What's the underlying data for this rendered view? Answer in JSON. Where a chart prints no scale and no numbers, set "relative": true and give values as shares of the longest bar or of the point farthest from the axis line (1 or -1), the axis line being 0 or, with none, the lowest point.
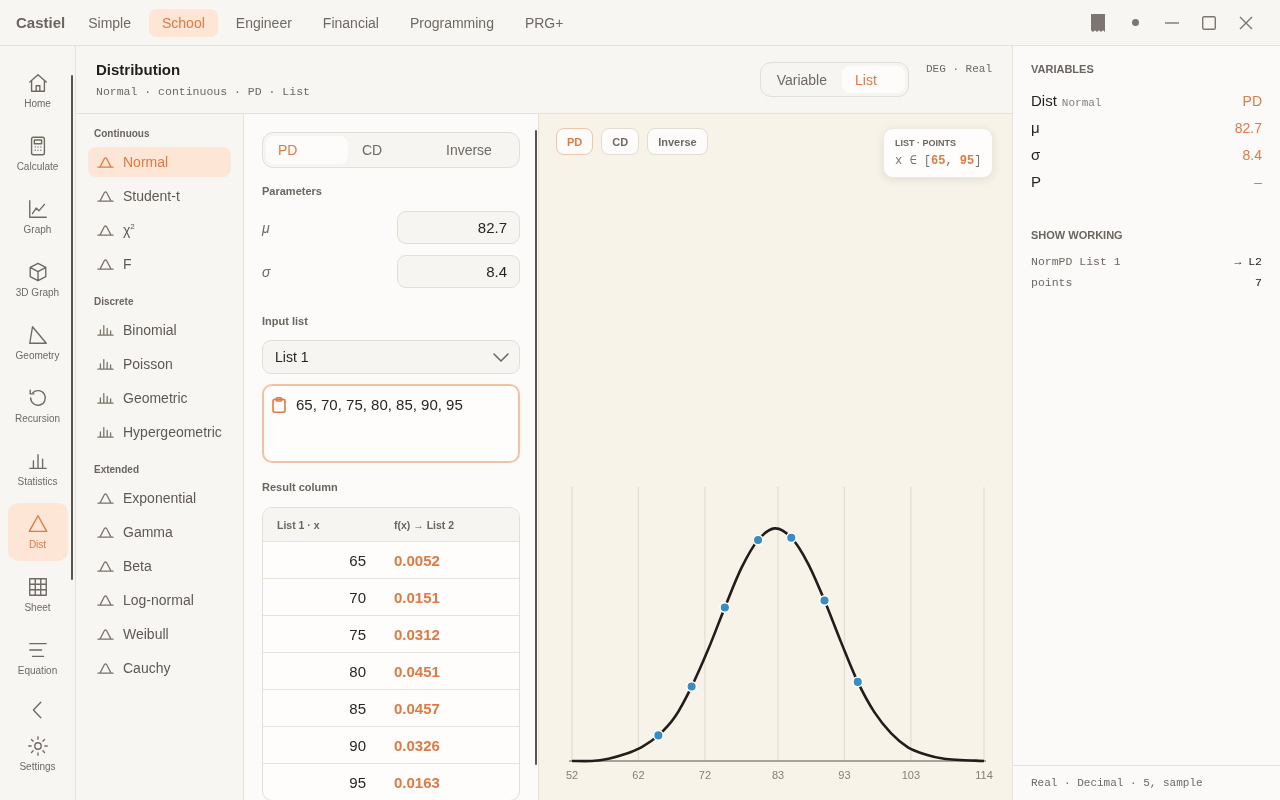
{
  "app": {
    "name": "Castiel"
  },
  "mode_tabs": [
    {
      "label": "Simple",
      "selected": false
    },
    {
      "label": "School",
      "selected": true
    },
    {
      "label": "Engineer",
      "selected": false
    },
    {
      "label": "Financial",
      "selected": false
    },
    {
      "label": "Programming",
      "selected": false
    },
    {
      "label": "PRG+",
      "selected": false
    }
  ],
  "nav": {
    "items": [
      {
        "label": "Home",
        "selected": false
      },
      {
        "label": "Calculate",
        "selected": false
      },
      {
        "label": "Graph",
        "selected": false
      },
      {
        "label": "3D Graph",
        "selected": false
      },
      {
        "label": "Geometry",
        "selected": false
      },
      {
        "label": "Recursion",
        "selected": false
      },
      {
        "label": "Statistics",
        "selected": false
      },
      {
        "label": "Dist",
        "selected": true
      },
      {
        "label": "Sheet",
        "selected": false
      },
      {
        "label": "Equation",
        "selected": false
      }
    ],
    "settings": {
      "label": "Settings",
      "selected": false
    }
  },
  "header": {
    "title": "Distribution",
    "subtitle": "Normal · continuous · PD · List"
  },
  "view_toggle": [
    {
      "label": "Variable",
      "selected": false
    },
    {
      "label": "List",
      "selected": true
    }
  ],
  "angle_status": "DEG · Real",
  "distributions": [
    {
      "heading": "Continuous",
      "items": [
        {
          "label": "Normal",
          "kind": "continuous",
          "selected": true
        },
        {
          "label": "Student-t",
          "kind": "continuous",
          "selected": false
        },
        {
          "label": "χ$^{2}$",
          "kind": "continuous",
          "selected": false
        },
        {
          "label": "F",
          "kind": "continuous",
          "selected": false
        }
      ]
    },
    {
      "heading": "Discrete",
      "items": [
        {
          "label": "Binomial",
          "kind": "discrete",
          "selected": false
        },
        {
          "label": "Poisson",
          "kind": "discrete",
          "selected": false
        },
        {
          "label": "Geometric",
          "kind": "discrete",
          "selected": false
        },
        {
          "label": "Hypergeometric",
          "kind": "discrete",
          "selected": false
        }
      ]
    },
    {
      "heading": "Extended",
      "items": [
        {
          "label": "Exponential",
          "kind": "continuous",
          "selected": false
        },
        {
          "label": "Gamma",
          "kind": "continuous",
          "selected": false
        },
        {
          "label": "Beta",
          "kind": "continuous",
          "selected": false
        },
        {
          "label": "Log-normal",
          "kind": "continuous",
          "selected": false
        },
        {
          "label": "Weibull",
          "kind": "continuous",
          "selected": false
        },
        {
          "label": "Cauchy",
          "kind": "continuous",
          "selected": false
        }
      ]
    }
  ],
  "function_toggle": [
    {
      "label": "PD",
      "selected": true
    },
    {
      "label": "CD",
      "selected": false
    },
    {
      "label": "Inverse",
      "selected": false
    }
  ],
  "parameters": {
    "heading": "Parameters",
    "fields": [
      {
        "label": "μ",
        "value": "82.7"
      },
      {
        "label": "σ",
        "value": "8.4"
      }
    ]
  },
  "input_list": {
    "heading": "Input list",
    "dropdown": "List 1",
    "values": "65, 70, 75, 80, 85, 90, 95"
  },
  "result": {
    "heading": "Result column",
    "columns": [
      "List 1 · x",
      "f(x) → List 2"
    ],
    "rows": [
      [
        "65",
        "0.0052"
      ],
      [
        "70",
        "0.0151"
      ],
      [
        "75",
        "0.0312"
      ],
      [
        "80",
        "0.0451"
      ],
      [
        "85",
        "0.0457"
      ],
      [
        "90",
        "0.0326"
      ],
      [
        "95",
        "0.0163"
      ]
    ]
  },
  "chart_panel": {
    "buttons": [
      {
        "label": "PD",
        "selected": true
      },
      {
        "label": "CD",
        "selected": false
      },
      {
        "label": "Inverse",
        "selected": false
      }
    ],
    "legend": {
      "title": "LIST · POINTS",
      "range": "x ∈ [**65**, **95**]"
    },
    "chart_data": {
      "type": "line",
      "relative": true,
      "grid": true,
      "x": [
        52,
        55,
        57.5,
        60,
        62.5,
        65,
        67.5,
        70,
        72.5,
        75,
        77.5,
        80,
        82.5,
        85,
        87.5,
        90,
        92.5,
        95,
        97.5,
        100,
        102.5,
        105,
        108,
        114
      ],
      "series": [
        {
          "values": [
            0.0,
            0.0,
            0.01,
            0.03,
            0.06,
            0.11,
            0.19,
            0.32,
            0.48,
            0.66,
            0.83,
            0.95,
            1.0,
            0.96,
            0.85,
            0.69,
            0.51,
            0.34,
            0.21,
            0.12,
            0.06,
            0.03,
            0.01,
            0.0
          ]
        }
      ],
      "xlim": [
        52,
        114
      ],
      "xticks": [
        52,
        62,
        72,
        83,
        93,
        103,
        114
      ]
    }
  },
  "variables": {
    "heading": "VARIABLES",
    "rows": [
      {
        "name": "Dist",
        "note": "Normal",
        "value": "PD"
      },
      {
        "name": "μ",
        "value": "82.7"
      },
      {
        "name": "σ",
        "value": "8.4"
      },
      {
        "name": "P",
        "value": "–"
      }
    ]
  },
  "working": {
    "heading": "SHOW WORKING",
    "rows": [
      {
        "label": "NormPD List 1",
        "value": "→ L2"
      },
      {
        "label": "points",
        "value": "7"
      }
    ]
  },
  "status_bar": "Real · Decimal · 5, sample"
}
